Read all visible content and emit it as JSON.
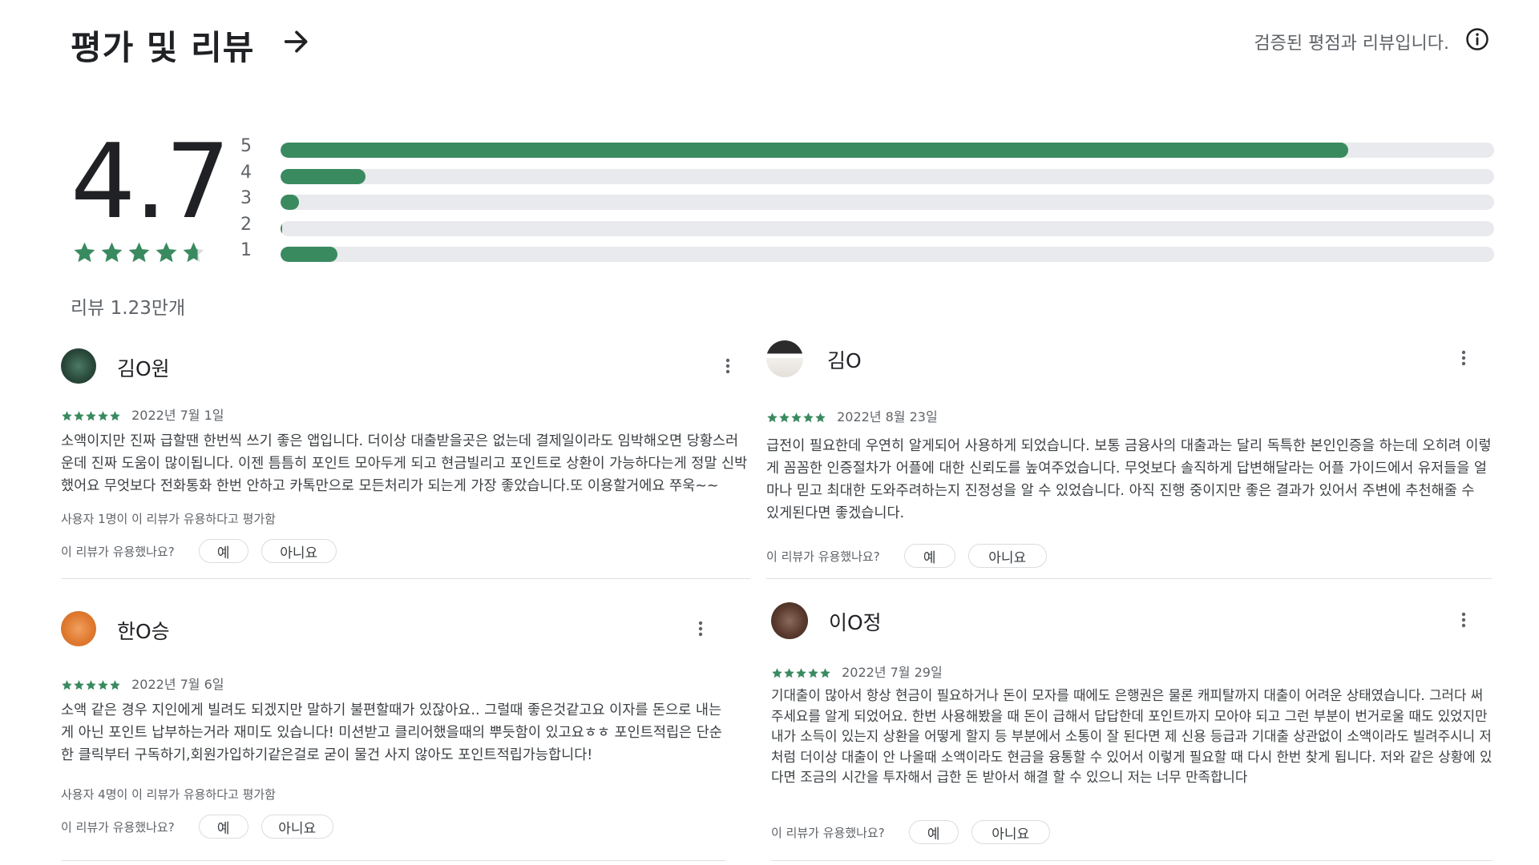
{
  "header": {
    "title": "평가 및 리뷰",
    "verified_text": "검증된 평점과 리뷰입니다."
  },
  "summary": {
    "average": "4.7",
    "rating_value": 4.7,
    "review_count": "리뷰 1.23만개",
    "distribution": [
      {
        "label": "5",
        "fraction": 0.88
      },
      {
        "label": "4",
        "fraction": 0.07
      },
      {
        "label": "3",
        "fraction": 0.015
      },
      {
        "label": "2",
        "fraction": 0.0
      },
      {
        "label": "1",
        "fraction": 0.047
      }
    ],
    "accent_color": "#3a8a5f"
  },
  "helpful_question": "이 리뷰가 유용했나요?",
  "yes_label": "예",
  "no_label": "아니요",
  "reviews": [
    {
      "author": "김O원",
      "stars": 5,
      "date": "2022년 7월 1일",
      "text": "소액이지만 진짜 급할땐 한번씩 쓰기 좋은 앱입니다. 더이상 대출받을곳은 없는데 결제일이라도 임박해오면 당황스러운데 진짜 도움이 많이됩니다. 이젠 틈틈히 포인트 모아두게 되고 현금빌리고 포인트로 상환이 가능하다는게 정말 신박했어요 무엇보다 전화통화 한번 안하고 카톡만으로 모든처리가 되는게 가장 좋았습니다.또 이용할거에요 쭈욱~~",
      "helpful_count": "사용자 1명이 이 리뷰가 유용하다고 평가함"
    },
    {
      "author": "김O",
      "stars": 5,
      "date": "2022년 8월 23일",
      "text": "급전이 필요한데 우연히 알게되어 사용하게 되었습니다. 보통 금융사의 대출과는 달리 독특한 본인인증을 하는데 오히려 이렇게 꼼꼼한 인증절차가 어플에 대한 신뢰도를 높여주었습니다. 무엇보다 솔직하게 답변해달라는 어플 가이드에서 유저들을 얼마나 믿고 최대한 도와주려하는지 진정성을 알 수 있었습니다. 아직 진행 중이지만 좋은 결과가 있어서 주변에 추천해줄 수 있게된다면 좋겠습니다.",
      "helpful_count": ""
    },
    {
      "author": "한O승",
      "stars": 5,
      "date": "2022년 7월 6일",
      "text": "소액 같은 경우 지인에게 빌려도 되겠지만 말하기 불편할때가 있잖아요.. 그럴때 좋은것같고요 이자를 돈으로 내는게 아닌 포인트 납부하는거라 재미도 있습니다! 미션받고 클리어했을때의 뿌듯함이 있고요ㅎㅎ 포인트적립은 단순한 클릭부터 구독하기,회원가입하기같은걸로 굳이 물건 사지 않아도 포인트적립가능합니다!",
      "helpful_count": "사용자 4명이 이 리뷰가 유용하다고 평가함"
    },
    {
      "author": "이O정",
      "stars": 5,
      "date": "2022년 7월 29일",
      "text": "기대출이 많아서 항상 현금이 필요하거나 돈이 모자를 때에도 은행권은 물론 캐피탈까지 대출이 어려운 상태였습니다. 그러다 써주세요를 알게 되었어요. 한번 사용해봤을 때 돈이 급해서 답답한데 포인트까지 모아야 되고 그런 부분이 번거로울 때도 있었지만 내가 소득이 있는지 상환을 어떻게 할지 등 부분에서 소통이 잘 된다면 제 신용 등급과 기대출 상관없이 소액이라도 빌려주시니 저처럼 더이상 대출이 안 나올때 소액이라도 현금을 융통할 수 있어서 이렇게 필요할 때 다시 한번 찾게 됩니다. 저와 같은 상황에 있다면 조금의 시간을 투자해서 급한 돈 받아서 해결 할 수 있으니 저는 너무 만족합니다",
      "helpful_count": ""
    }
  ]
}
